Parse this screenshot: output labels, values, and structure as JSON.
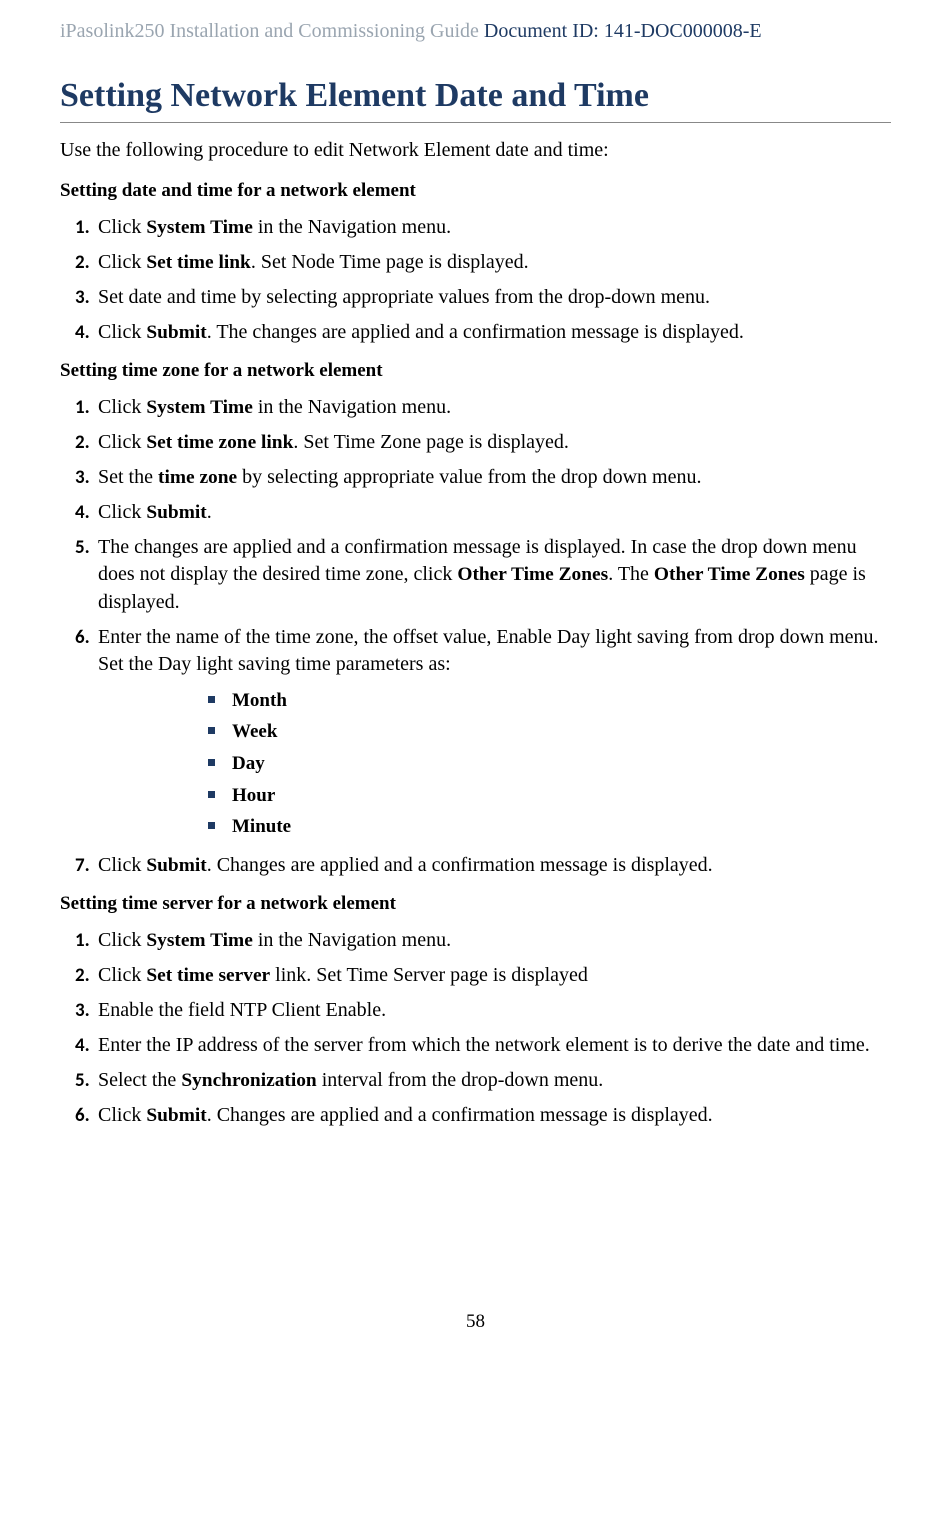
{
  "header": {
    "product": "iPasolink250 Installation and Commissioning Guide ",
    "doc_id": "Document ID: 141-DOC000008-E"
  },
  "title": "Setting Network Element Date and Time",
  "intro": "Use the following procedure to edit Network Element date and time:",
  "section1": {
    "title": "Setting date and time for a network element",
    "s1_pre": "Click ",
    "s1_b": "System Time",
    "s1_post": " in the Navigation menu.",
    "s2_pre": "Click ",
    "s2_b": "Set time link",
    "s2_post": ". Set Node Time page is displayed.",
    "s3": "Set date and time by selecting appropriate values from the drop-down menu.",
    "s4_pre": "Click ",
    "s4_b": "Submit",
    "s4_post": ". The changes are applied and a confirmation message is displayed."
  },
  "section2": {
    "title": "Setting time zone for a network element",
    "s1_pre": "Click ",
    "s1_b": "System Time",
    "s1_post": " in the Navigation menu.",
    "s2_pre": "Click ",
    "s2_b": "Set time zone link",
    "s2_post": ". Set Time Zone page is displayed.",
    "s3_pre": "Set the ",
    "s3_b": "time zone",
    "s3_post": " by selecting appropriate value from the drop down menu.",
    "s4_pre": "Click ",
    "s4_b": "Submit",
    "s4_post": ".",
    "s5_pre": "The changes are applied and a confirmation message is displayed. In case the drop down menu does not display the desired time zone, click ",
    "s5_b1": "Other Time Zones",
    "s5_mid": ". The ",
    "s5_b2": "Other Time Zones",
    "s5_post": " page is displayed.",
    "s6": "Enter the name of the time zone, the offset value, Enable Day light saving from drop down menu. Set the Day light saving time parameters as:",
    "bullets": {
      "b1": "Month",
      "b2": "Week",
      "b3": "Day",
      "b4": "Hour",
      "b5": "Minute"
    },
    "s7_pre": "Click ",
    "s7_b": "Submit",
    "s7_post": ". Changes are applied and a confirmation message is displayed."
  },
  "section3": {
    "title": "Setting time server for a network element",
    "s1_pre": "Click ",
    "s1_b": "System Time",
    "s1_post": " in the Navigation menu.",
    "s2_pre": "Click ",
    "s2_b": "Set time server",
    "s2_post": " link. Set Time Server page is displayed",
    "s3": "Enable the field NTP Client Enable.",
    "s4": "Enter the IP address of the server from which the network element is to derive the date and time.",
    "s5_pre": "Select the ",
    "s5_b": "Synchronization",
    "s5_post": " interval from the drop-down menu.",
    "s6_pre": "Click ",
    "s6_b": "Submit",
    "s6_post": ". Changes are applied and a confirmation message is displayed."
  },
  "page_number": "58"
}
